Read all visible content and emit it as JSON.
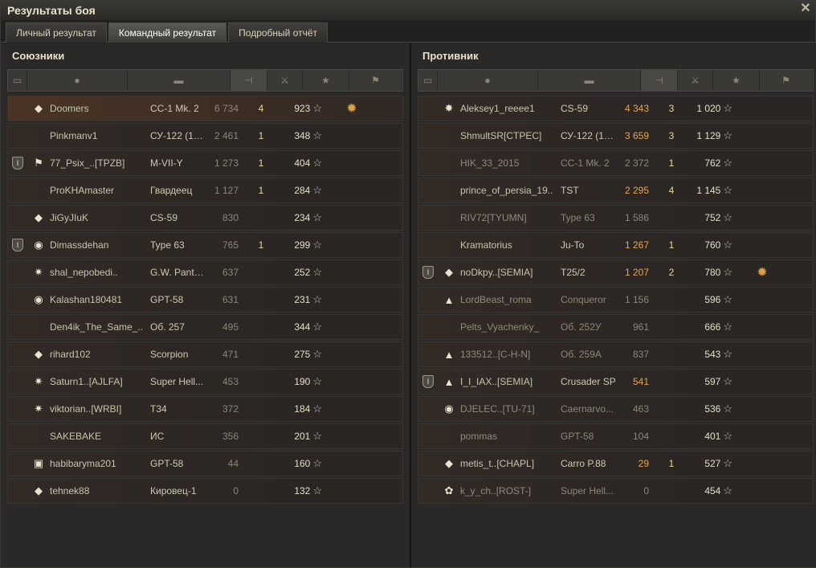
{
  "window": {
    "title": "Результаты боя",
    "close_icon": "close-icon"
  },
  "tabs": [
    {
      "label": "Личный результат",
      "active": false
    },
    {
      "label": "Командный результат",
      "active": true
    },
    {
      "label": "Подробный отчёт",
      "active": false
    }
  ],
  "allies": {
    "title": "Союзники",
    "rows": [
      {
        "badge": "",
        "clan": "◆",
        "name": "Doomers",
        "vehicle": "СС-1 Mk. 2",
        "damage": "6 734",
        "kills": "4",
        "xp": "923",
        "medal": "✹",
        "me": true,
        "dim": false
      },
      {
        "badge": "",
        "clan": "",
        "name": "Pinkmanv1",
        "vehicle": "СУ-122 (19...",
        "damage": "2 461",
        "kills": "1",
        "xp": "348",
        "medal": "",
        "me": false,
        "dim": false
      },
      {
        "badge": "I",
        "clan": "⚑",
        "name": "77_Psix_..[TPZB]",
        "vehicle": "M-VII-Y",
        "damage": "1 273",
        "kills": "1",
        "xp": "404",
        "medal": "",
        "me": false,
        "dim": false
      },
      {
        "badge": "",
        "clan": "",
        "name": "ProKHAmaster",
        "vehicle": "Гвардеец",
        "damage": "1 127",
        "kills": "1",
        "xp": "284",
        "medal": "",
        "me": false,
        "dim": false
      },
      {
        "badge": "",
        "clan": "◆",
        "name": "JiGyJIuK",
        "vehicle": "CS-59",
        "damage": "830",
        "kills": "",
        "xp": "234",
        "medal": "",
        "me": false,
        "dim": false
      },
      {
        "badge": "I",
        "clan": "◉",
        "name": "Dimassdehan",
        "vehicle": "Type 63",
        "damage": "765",
        "kills": "1",
        "xp": "299",
        "medal": "",
        "me": false,
        "dim": false
      },
      {
        "badge": "",
        "clan": "✷",
        "name": "shal_nepobedi..",
        "vehicle": "G.W. Panth...",
        "damage": "637",
        "kills": "",
        "xp": "252",
        "medal": "",
        "me": false,
        "dim": false
      },
      {
        "badge": "",
        "clan": "◉",
        "name": "Kalashan180481",
        "vehicle": "GPT-58",
        "damage": "631",
        "kills": "",
        "xp": "231",
        "medal": "",
        "me": false,
        "dim": false
      },
      {
        "badge": "",
        "clan": "",
        "name": "Den4ik_The_Same_..",
        "vehicle": "Об. 257",
        "damage": "495",
        "kills": "",
        "xp": "344",
        "medal": "",
        "me": false,
        "dim": false
      },
      {
        "badge": "",
        "clan": "◆",
        "name": "rihard102",
        "vehicle": "Scorpion",
        "damage": "471",
        "kills": "",
        "xp": "275",
        "medal": "",
        "me": false,
        "dim": false
      },
      {
        "badge": "",
        "clan": "✷",
        "name": "Saturn1..[AJLFA]",
        "vehicle": "Super Hell...",
        "damage": "453",
        "kills": "",
        "xp": "190",
        "medal": "",
        "me": false,
        "dim": false
      },
      {
        "badge": "",
        "clan": "✷",
        "name": "viktorian..[WRBI]",
        "vehicle": "T34",
        "damage": "372",
        "kills": "",
        "xp": "184",
        "medal": "",
        "me": false,
        "dim": false
      },
      {
        "badge": "",
        "clan": "",
        "name": "SAKEBAKE",
        "vehicle": "ИС",
        "damage": "356",
        "kills": "",
        "xp": "201",
        "medal": "",
        "me": false,
        "dim": false
      },
      {
        "badge": "",
        "clan": "▣",
        "name": "habibaryma201",
        "vehicle": "GPT-58",
        "damage": "44",
        "kills": "",
        "xp": "160",
        "medal": "",
        "me": false,
        "dim": false
      },
      {
        "badge": "",
        "clan": "◆",
        "name": "tehnek88",
        "vehicle": "Кировец-1",
        "damage": "0",
        "kills": "",
        "xp": "132",
        "medal": "",
        "me": false,
        "dim": false
      }
    ]
  },
  "enemies": {
    "title": "Противник",
    "rows": [
      {
        "badge": "",
        "clan": "✸",
        "name": "Aleksey1_reeee1",
        "vehicle": "CS-59",
        "damage": "4 343",
        "kills": "3",
        "xp": "1 020",
        "medal": "",
        "hi": true,
        "dim": false
      },
      {
        "badge": "",
        "clan": "",
        "name": "ShmultSR[CTPEC]",
        "vehicle": "СУ-122 (19...",
        "damage": "3 659",
        "kills": "3",
        "xp": "1 129",
        "medal": "",
        "hi": true,
        "dim": false
      },
      {
        "badge": "",
        "clan": "",
        "name": "HIK_33_2015",
        "vehicle": "СС-1 Mk. 2",
        "damage": "2 372",
        "kills": "1",
        "xp": "762",
        "medal": "",
        "hi": false,
        "dim": true
      },
      {
        "badge": "",
        "clan": "",
        "name": "prince_of_persia_19..",
        "vehicle": "TST",
        "damage": "2 295",
        "kills": "4",
        "xp": "1 145",
        "medal": "",
        "hi": true,
        "dim": false
      },
      {
        "badge": "",
        "clan": "",
        "name": "RIV72[TYUMN]",
        "vehicle": "Type 63",
        "damage": "1 586",
        "kills": "",
        "xp": "752",
        "medal": "",
        "hi": false,
        "dim": true
      },
      {
        "badge": "",
        "clan": "",
        "name": "Kramatorius",
        "vehicle": "Ju-To",
        "damage": "1 267",
        "kills": "1",
        "xp": "760",
        "medal": "",
        "hi": true,
        "dim": false
      },
      {
        "badge": "I",
        "clan": "◆",
        "name": "noDkpy..[SEMIA]",
        "vehicle": "T25/2",
        "damage": "1 207",
        "kills": "2",
        "xp": "780",
        "medal": "✹",
        "hi": true,
        "dim": false
      },
      {
        "badge": "",
        "clan": "▲",
        "name": "LordBeast_roma",
        "vehicle": "Conqueror",
        "damage": "1 156",
        "kills": "",
        "xp": "596",
        "medal": "",
        "hi": false,
        "dim": true
      },
      {
        "badge": "",
        "clan": "",
        "name": "Pelts_Vyachenky_",
        "vehicle": "Об. 252У",
        "damage": "961",
        "kills": "",
        "xp": "666",
        "medal": "",
        "hi": false,
        "dim": true
      },
      {
        "badge": "",
        "clan": "▲",
        "name": "133512..[C-H-N]",
        "vehicle": "Об. 259А",
        "damage": "837",
        "kills": "",
        "xp": "543",
        "medal": "",
        "hi": false,
        "dim": true
      },
      {
        "badge": "I",
        "clan": "▲",
        "name": "I_I_IAX..[SEMIA]",
        "vehicle": "Crusader SP",
        "damage": "541",
        "kills": "",
        "xp": "597",
        "medal": "",
        "hi": true,
        "dim": false
      },
      {
        "badge": "",
        "clan": "◉",
        "name": "DJELEC..[TU-71]",
        "vehicle": "Caernarvo...",
        "damage": "463",
        "kills": "",
        "xp": "536",
        "medal": "",
        "hi": false,
        "dim": true
      },
      {
        "badge": "",
        "clan": "",
        "name": "pommas",
        "vehicle": "GPT-58",
        "damage": "104",
        "kills": "",
        "xp": "401",
        "medal": "",
        "hi": false,
        "dim": true
      },
      {
        "badge": "",
        "clan": "◆",
        "name": "metis_t..[CHAPL]",
        "vehicle": "Carro P.88",
        "damage": "29",
        "kills": "1",
        "xp": "527",
        "medal": "",
        "hi": true,
        "dim": false
      },
      {
        "badge": "",
        "clan": "✿",
        "name": "k_y_ch..[ROST-]",
        "vehicle": "Super Hell...",
        "damage": "0",
        "kills": "",
        "xp": "454",
        "medal": "",
        "hi": false,
        "dim": true
      }
    ]
  },
  "columns_icons": [
    "badge-icon",
    "player-icon",
    "tank-icon",
    "damage-icon",
    "kills-icon",
    "xp-star-icon",
    "medal-icon"
  ]
}
